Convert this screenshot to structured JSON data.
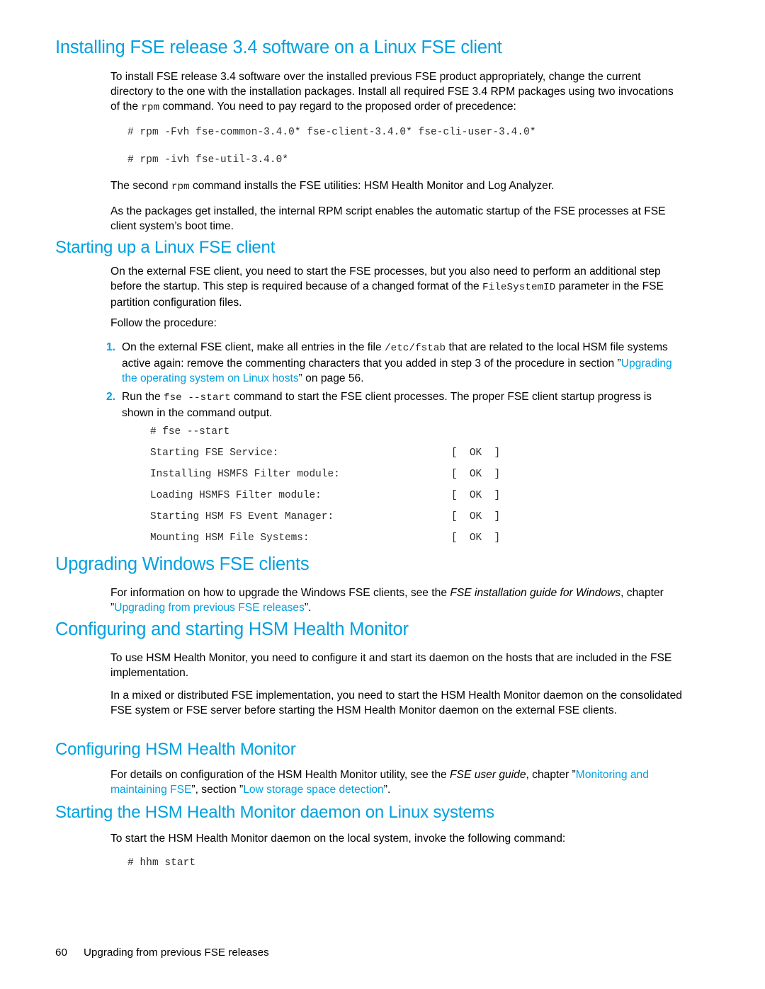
{
  "document": {
    "page_number": "60",
    "footer_title": "Upgrading from previous FSE releases",
    "accent_color": "#00a0df"
  },
  "sections": {
    "installing": {
      "heading": "Installing FSE release 3.4 software on a Linux FSE client",
      "para1_a": "To install FSE release 3.4 software over the installed previous FSE product appropriately, change the current directory to the one with the installation packages. Install all required FSE 3.4 RPM packages using two invocations of the ",
      "para1_code": "rpm",
      "para1_b": " command. You need to pay regard to the proposed order of precedence:",
      "code1": "# rpm -Fvh fse-common-3.4.0* fse-client-3.4.0* fse-cli-user-3.4.0*",
      "code2": "# rpm -ivh fse-util-3.4.0*",
      "para2_a": "The second ",
      "para2_code": "rpm",
      "para2_b": " command installs the FSE utilities: HSM Health Monitor and Log Analyzer.",
      "para3": "As the packages get installed, the internal RPM script enables the automatic startup of the FSE processes at FSE client system’s boot time."
    },
    "starting_up": {
      "heading": "Starting up a Linux FSE client",
      "para1_a": "On the external FSE client, you need to start the FSE processes, but you also need to perform an additional step before the startup. This step is required because of a changed format of the ",
      "para1_code": "FileSystemID",
      "para1_b": " parameter in the FSE partition configuration files.",
      "para2": "Follow the procedure:",
      "steps": [
        {
          "number": "1.",
          "text_a": "On the external FSE client, make all entries in the file ",
          "code": "/etc/fstab",
          "text_b": " that are related to the local HSM file systems active again: remove the commenting characters that you added in step 3 of the procedure in section ”",
          "link": "Upgrading the operating system on Linux hosts",
          "text_c": "” on page 56."
        },
        {
          "number": "2.",
          "text_a": "Run the ",
          "code": "fse --start",
          "text_b": " command to start the FSE client processes. The proper FSE client startup progress is shown in the command output.",
          "link": "",
          "text_c": ""
        }
      ],
      "terminal": {
        "command": "# fse --start",
        "rows": [
          {
            "label": "Starting FSE Service:",
            "status": "[  OK  ]"
          },
          {
            "label": "Installing HSMFS Filter module:",
            "status": "[  OK  ]"
          },
          {
            "label": "Loading HSMFS Filter module:",
            "status": "[  OK  ]"
          },
          {
            "label": "Starting HSM FS Event Manager:",
            "status": "[  OK  ]"
          },
          {
            "label": "Mounting HSM File Systems:",
            "status": "[  OK  ]"
          }
        ]
      }
    },
    "upgrading_windows": {
      "heading": "Upgrading Windows FSE clients",
      "para_a": "For information on how to upgrade the Windows FSE clients, see the ",
      "para_italic": "FSE installation guide for Windows",
      "para_b": ", chapter ”",
      "para_link": "Upgrading from previous FSE releases",
      "para_c": "”."
    },
    "configuring_starting_hhm": {
      "heading": "Configuring and starting HSM Health Monitor",
      "para1": "To use HSM Health Monitor, you need to configure it and start its daemon on the hosts that are included in the FSE implementation.",
      "para2": "In a mixed or distributed FSE implementation, you need to start the HSM Health Monitor daemon on the consolidated FSE system or FSE server before starting the HSM Health Monitor daemon on the external FSE clients."
    },
    "configuring_hhm": {
      "heading": "Configuring HSM Health Monitor",
      "para_a": "For details on configuration of the HSM Health Monitor utility, see the ",
      "para_italic": "FSE user guide",
      "para_b": ", chapter ”",
      "para_link1": "Monitoring and maintaining FSE",
      "para_c": "”, section ”",
      "para_link2": "Low storage space detection",
      "para_d": "”."
    },
    "starting_hhm_daemon": {
      "heading": "Starting the HSM Health Monitor daemon on Linux systems",
      "para": "To start the HSM Health Monitor daemon on the local system, invoke the following command:",
      "code": "# hhm start"
    }
  }
}
